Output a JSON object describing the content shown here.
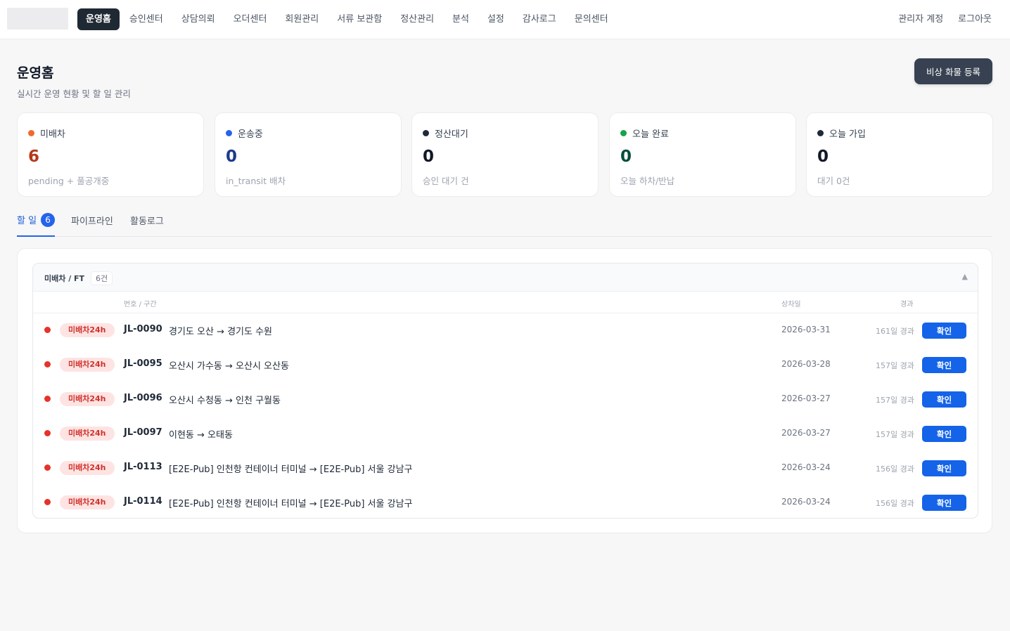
{
  "nav": {
    "items": [
      "운영홈",
      "승인센터",
      "상담의뢰",
      "오더센터",
      "회원관리",
      "서류 보관함",
      "정산관리",
      "분석",
      "설정",
      "감사로그",
      "문의센터"
    ],
    "active": "운영홈",
    "admin_account": "관리자 계정",
    "logout": "로그아웃"
  },
  "header": {
    "title": "운영홈",
    "subtitle": "실시간 운영 현황 및 할 일 관리",
    "emergency_button": "비상 화물 등록"
  },
  "stats": [
    {
      "label": "미배차",
      "value": "6",
      "desc": "pending + 풀공개중",
      "color": "#f06a2b",
      "value_color": "#b5391a"
    },
    {
      "label": "운송중",
      "value": "0",
      "desc": "in_transit 배차",
      "color": "#2563eb",
      "value_color": "#1e3a8a"
    },
    {
      "label": "정산대기",
      "value": "0",
      "desc": "승인 대기 건",
      "color": "#1f2937",
      "value_color": "#111827"
    },
    {
      "label": "오늘 완료",
      "value": "0",
      "desc": "오늘 하차/반납",
      "color": "#16a34a",
      "value_color": "#064e3b"
    },
    {
      "label": "오늘 가입",
      "value": "0",
      "desc": "대기 0건",
      "color": "#1f2937",
      "value_color": "#111827"
    }
  ],
  "tabs": {
    "todo": "할 일",
    "todo_count": "6",
    "pipeline": "파이프라인",
    "activity": "활동로그"
  },
  "group": {
    "title": "미배차 / FT",
    "count": "6건",
    "collapse_icon": "▲",
    "columns": {
      "number_route": "번호 / 구간",
      "date": "상차일",
      "elapsed": "경과"
    },
    "rows": [
      {
        "status": "미배차24h",
        "code": "JL-0090",
        "route": "경기도 오산 → 경기도 수원",
        "date": "2026-03-31",
        "elapsed": "161일 경과",
        "action": "확인"
      },
      {
        "status": "미배차24h",
        "code": "JL-0095",
        "route": "오산시 가수동 → 오산시 오산동",
        "date": "2026-03-28",
        "elapsed": "157일 경과",
        "action": "확인"
      },
      {
        "status": "미배차24h",
        "code": "JL-0096",
        "route": "오산시 수청동 → 인천 구월동",
        "date": "2026-03-27",
        "elapsed": "157일 경과",
        "action": "확인"
      },
      {
        "status": "미배차24h",
        "code": "JL-0097",
        "route": "이현동 → 오태동",
        "date": "2026-03-27",
        "elapsed": "157일 경과",
        "action": "확인"
      },
      {
        "status": "미배차24h",
        "code": "JL-0113",
        "route": "[E2E-Pub] 인천항 컨테이너 터미널 → [E2E-Pub] 서울 강남구",
        "date": "2026-03-24",
        "elapsed": "156일 경과",
        "action": "확인"
      },
      {
        "status": "미배차24h",
        "code": "JL-0114",
        "route": "[E2E-Pub] 인천항 컨테이너 터미널 → [E2E-Pub] 서울 강남구",
        "date": "2026-03-24",
        "elapsed": "156일 경과",
        "action": "확인"
      }
    ]
  },
  "colors": {
    "accent": "#2563eb",
    "dark_button": "#374151",
    "alert": "#e5332a"
  }
}
